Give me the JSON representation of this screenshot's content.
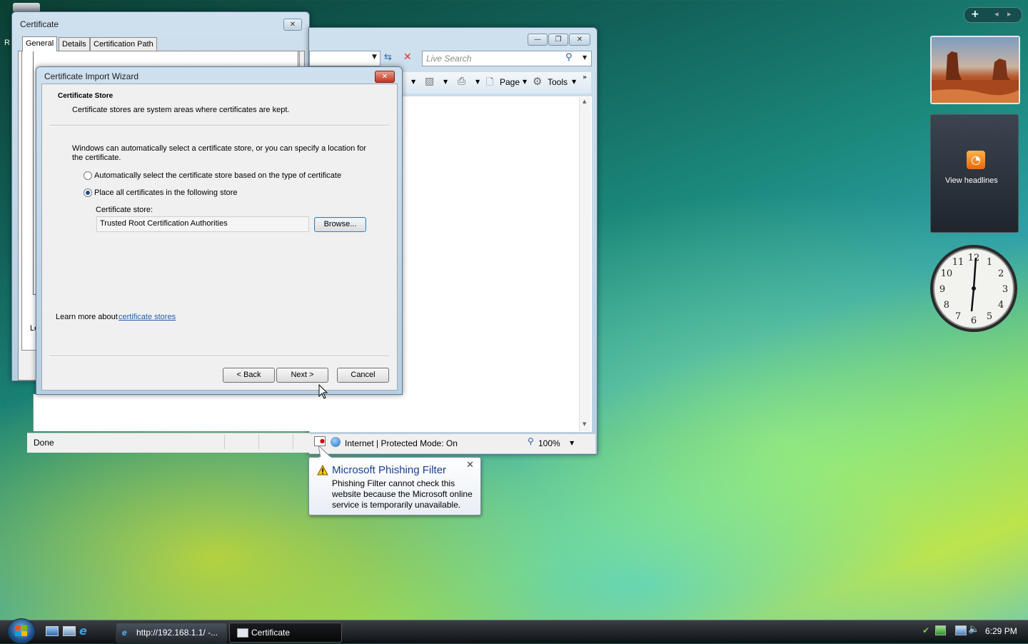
{
  "desktop": {
    "recycle_bin_partial_label": "R",
    "sidebar": {
      "add_symbol": "+",
      "prev_symbol": "◂",
      "next_symbol": "▸",
      "feed_label": "View headlines",
      "clock_numbers": [
        "12",
        "1",
        "2",
        "3",
        "4",
        "5",
        "6",
        "7",
        "8",
        "9",
        "10",
        "11"
      ]
    }
  },
  "certificate_window": {
    "title": "Certificate",
    "tabs": [
      "General",
      "Details",
      "Certification Path"
    ],
    "partial_text": "Le"
  },
  "ie_window": {
    "search_placeholder": "Live Search",
    "toolbar": {
      "page_label": "Page",
      "tools_label": "Tools"
    },
    "status": {
      "done": "Done",
      "zone": "Internet | Protected Mode: On",
      "zoom": "100%"
    }
  },
  "wizard": {
    "title": "Certificate Import Wizard",
    "header_title": "Certificate Store",
    "header_desc": "Certificate stores are system areas where certificates are kept.",
    "intro_line1": "Windows can automatically select a certificate store, or you can specify a location for",
    "intro_line2": "the certificate.",
    "option_auto": "Automatically select the certificate store based on the type of certificate",
    "option_place": "Place all certificates in the following store",
    "store_label": "Certificate store:",
    "store_value": "Trusted Root Certification Authorities",
    "browse_label": "Browse...",
    "learn_more_prefix": "Learn more about ",
    "learn_more_link": "certificate stores",
    "back_label": "< Back",
    "next_label": "Next >",
    "cancel_label": "Cancel"
  },
  "balloon": {
    "title": "Microsoft Phishing Filter",
    "line1": "Phishing Filter cannot check this",
    "line2": "website because the Microsoft online",
    "line3": "service is temporarily unavailable."
  },
  "taskbar": {
    "items": [
      {
        "label": "http://192.168.1.1/ -..."
      },
      {
        "label": "Certificate"
      }
    ],
    "time": "6:29 PM"
  }
}
